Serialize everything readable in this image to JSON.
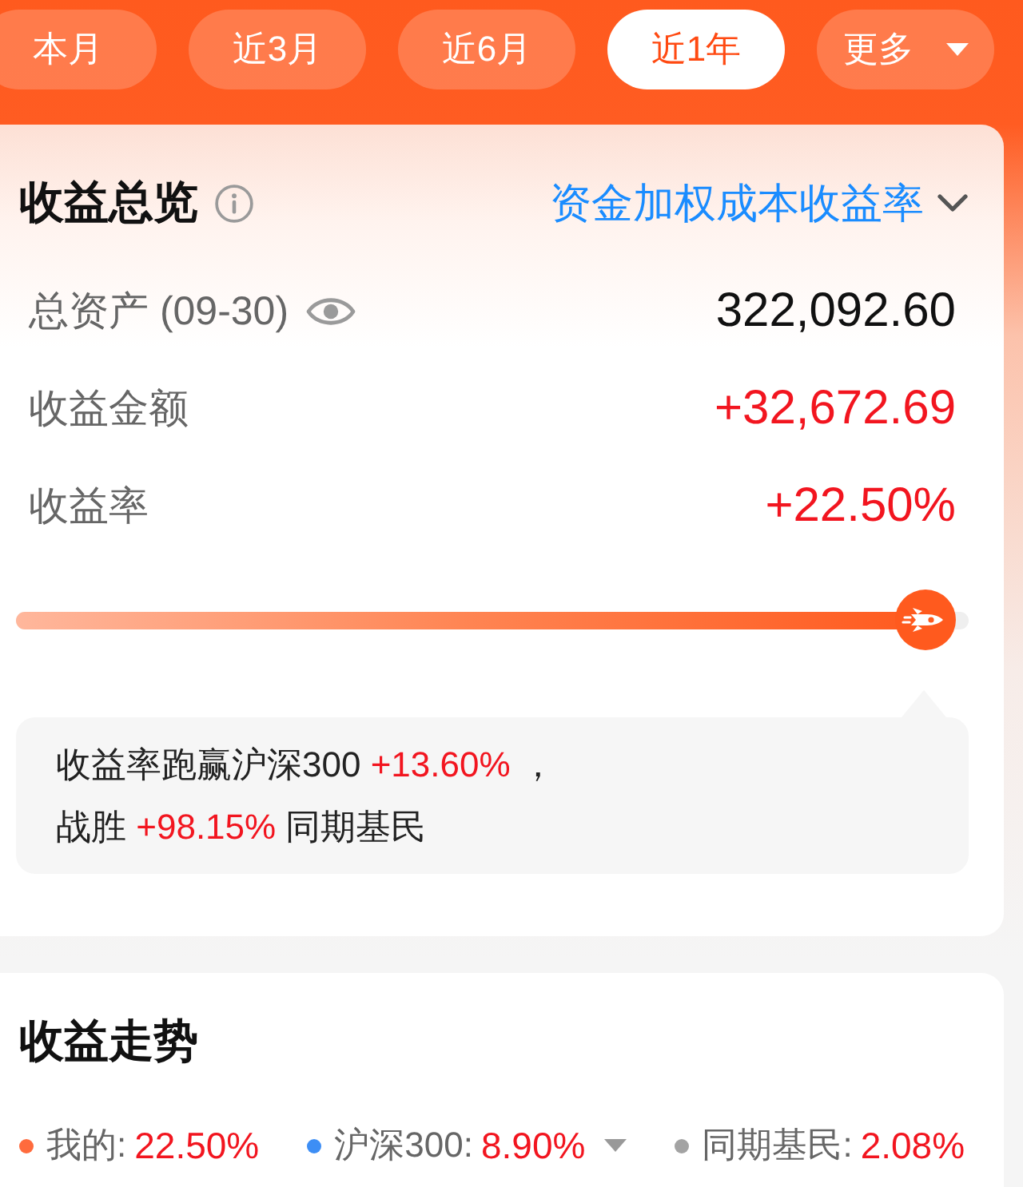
{
  "period_tabs": [
    {
      "label": "本月",
      "selected": false,
      "kind": "period"
    },
    {
      "label": "近3月",
      "selected": false,
      "kind": "period"
    },
    {
      "label": "近6月",
      "selected": false,
      "kind": "period"
    },
    {
      "label": "近1年",
      "selected": true,
      "kind": "period"
    },
    {
      "label": "更多",
      "selected": false,
      "kind": "menu"
    }
  ],
  "overview": {
    "title": "收益总览",
    "rate_selector": "资金加权成本收益率",
    "rows": [
      {
        "kind": "balance",
        "label": "总资产 (09-30)",
        "value": "322,092.60"
      },
      {
        "kind": "gain",
        "label": "收益金额",
        "value": "+32,672.69"
      },
      {
        "kind": "gain",
        "label": "收益率",
        "value": "+22.50%"
      }
    ],
    "progress": {
      "level": 0.955
    },
    "summary_lines": [
      "收益率跑赢沪深300 **+13.60%** ，",
      "战胜 **+98.15%** 同期基民"
    ]
  },
  "trend": {
    "title": "收益走势",
    "legend": [
      {
        "label": "我的:",
        "value": "22.50%",
        "color": "#ff6b3d",
        "has_menu": false
      },
      {
        "label": "沪深300:",
        "value": "8.90%",
        "color": "#3d8ef5",
        "has_menu": true
      },
      {
        "label": "同期基民:",
        "value": "2.08%",
        "color": "#a3a3a3",
        "has_menu": false
      }
    ]
  }
}
